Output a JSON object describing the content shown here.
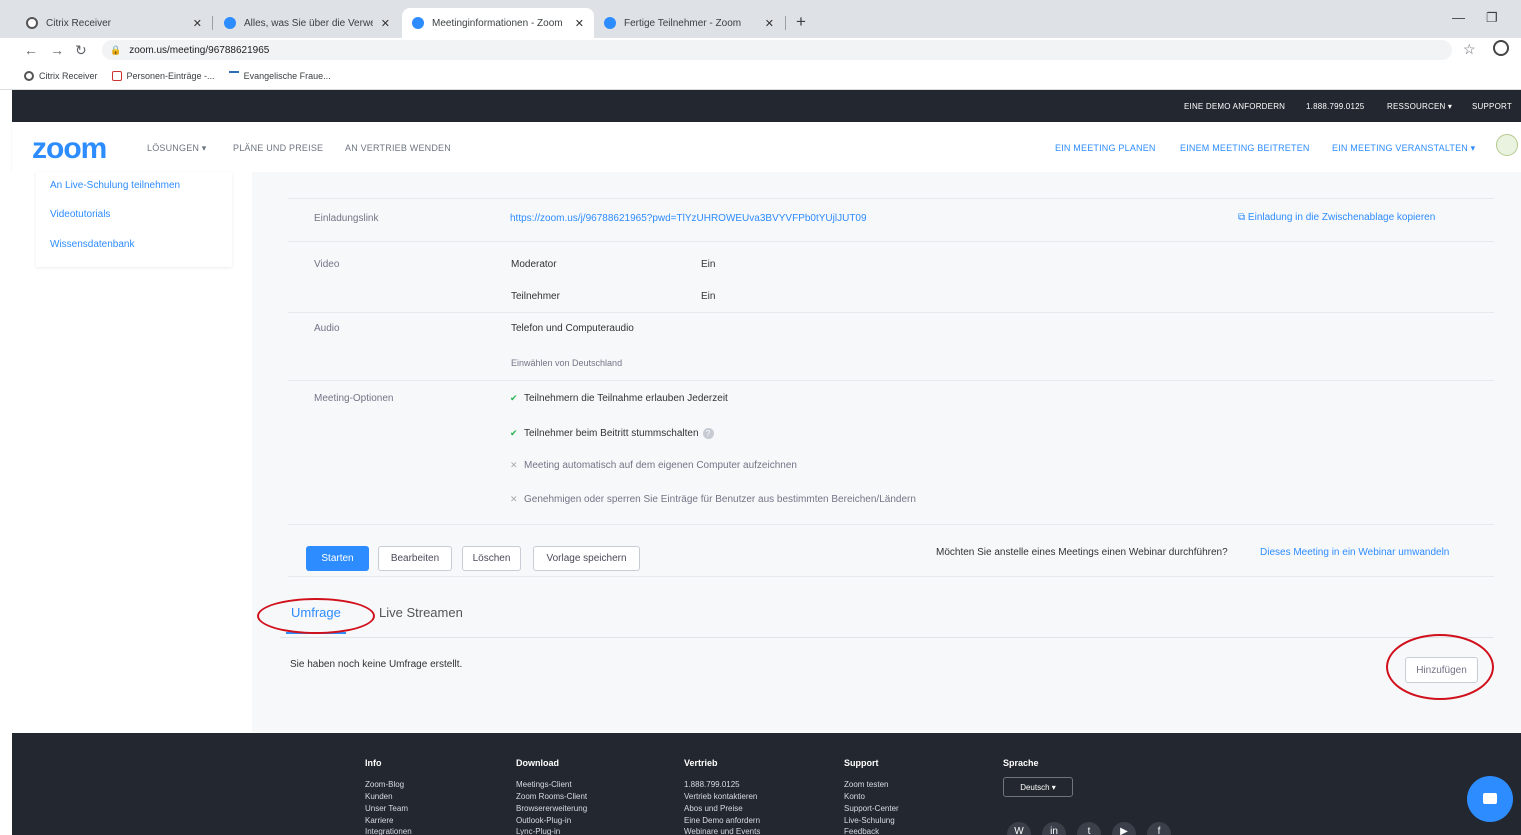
{
  "browser": {
    "tabs": [
      {
        "label": "Citrix Receiver",
        "icon": "citrix"
      },
      {
        "label": "Alles, was Sie über die Verwendu",
        "icon": "zoom"
      },
      {
        "label": "Meetinginformationen - Zoom",
        "icon": "zoom"
      },
      {
        "label": "Fertige Teilnehmer - Zoom",
        "icon": "zoom"
      }
    ],
    "url": "zoom.us/meeting/96788621965",
    "bookmarks": [
      "Citrix Receiver",
      "Personen-Einträge -...",
      "Evangelische Fraue..."
    ]
  },
  "topbar": {
    "demo": "EINE DEMO ANFORDERN",
    "phone": "1.888.799.0125",
    "resources": "RESSOURCEN ▾",
    "support": "SUPPORT"
  },
  "nav": {
    "logo": "zoom",
    "solutions": "LÖSUNGEN ▾",
    "plans": "PLÄNE UND PREISE",
    "sales": "AN VERTRIEB WENDEN",
    "schedule": "EIN MEETING PLANEN",
    "join": "EINEM MEETING BEITRETEN",
    "host": "EIN MEETING VERANSTALTEN ▾"
  },
  "sidebar": {
    "items": [
      "An Live-Schulung teilnehmen",
      "Videotutorials",
      "Wissensdatenbank"
    ]
  },
  "meeting": {
    "invite_label": "Einladungslink",
    "invite_link": "https://zoom.us/j/96788621965?pwd=TlYzUHROWEUva3BVYVFPb0tYUjlJUT09",
    "copy_invite": "Einladung in die Zwischenablage kopieren",
    "video_label": "Video",
    "host_label": "Moderator",
    "host_value": "Ein",
    "participant_label": "Teilnehmer",
    "participant_value": "Ein",
    "audio_label": "Audio",
    "audio_value": "Telefon und Computeraudio",
    "dialin": "Einwählen von Deutschland",
    "options_label": "Meeting-Optionen",
    "options": [
      {
        "text": "Teilnehmern die Teilnahme erlauben Jederzeit",
        "enabled": true
      },
      {
        "text": "Teilnehmer beim Beitritt stummschalten",
        "enabled": true
      },
      {
        "text": "Meeting automatisch auf dem eigenen Computer aufzeichnen",
        "enabled": false
      },
      {
        "text": "Genehmigen oder sperren Sie Einträge für Benutzer aus bestimmten Bereichen/Ländern",
        "enabled": false
      }
    ]
  },
  "actions": {
    "start": "Starten",
    "edit": "Bearbeiten",
    "delete": "Löschen",
    "save_template": "Vorlage speichern",
    "webinar_question": "Möchten Sie anstelle eines Meetings einen Webinar durchführen?",
    "webinar_link": "Dieses Meeting in ein Webinar umwandeln"
  },
  "poll": {
    "tab_poll": "Umfrage",
    "tab_stream": "Live Streamen",
    "empty": "Sie haben noch keine Umfrage erstellt.",
    "add": "Hinzufügen"
  },
  "footer": {
    "columns": [
      {
        "title": "Info",
        "links": [
          "Zoom-Blog",
          "Kunden",
          "Unser Team",
          "Karriere",
          "Integrationen"
        ]
      },
      {
        "title": "Download",
        "links": [
          "Meetings-Client",
          "Zoom Rooms-Client",
          "Browsererweiterung",
          "Outlook-Plug-in",
          "Lync-Plug-in"
        ]
      },
      {
        "title": "Vertrieb",
        "links": [
          "1.888.799.0125",
          "Vertrieb kontaktieren",
          "Abos und Preise",
          "Eine Demo anfordern",
          "Webinare und Events"
        ]
      },
      {
        "title": "Support",
        "links": [
          "Zoom testen",
          "Konto",
          "Support-Center",
          "Live-Schulung",
          "Feedback"
        ]
      }
    ],
    "language_title": "Sprache",
    "language_value": "Deutsch ▾"
  },
  "colors": {
    "accent": "#2d8cff",
    "annotation": "#d0101b",
    "dark": "#23272f"
  }
}
